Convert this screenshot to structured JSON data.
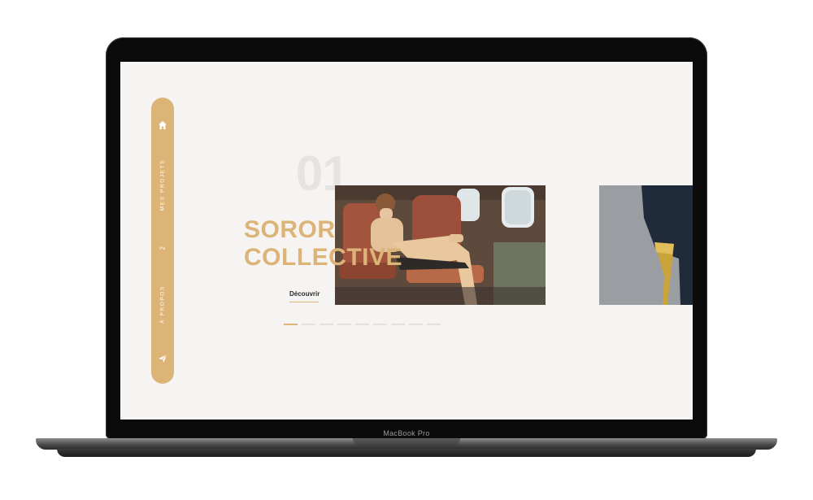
{
  "device": {
    "label": "MacBook Pro"
  },
  "sidebar": {
    "home_icon": "home-icon",
    "projects_label": "MES PROJETS",
    "index": "2",
    "about_label": "À PROPOS",
    "send_icon": "paper-plane-icon"
  },
  "hero": {
    "number": "01",
    "title_line1": "SOROR",
    "title_line2": "COLLECTIVE",
    "cta_label": "Découvrir"
  },
  "slider": {
    "total": 9,
    "active_index": 0
  },
  "colors": {
    "accent": "#dcb478",
    "background": "#f6f4f2"
  }
}
